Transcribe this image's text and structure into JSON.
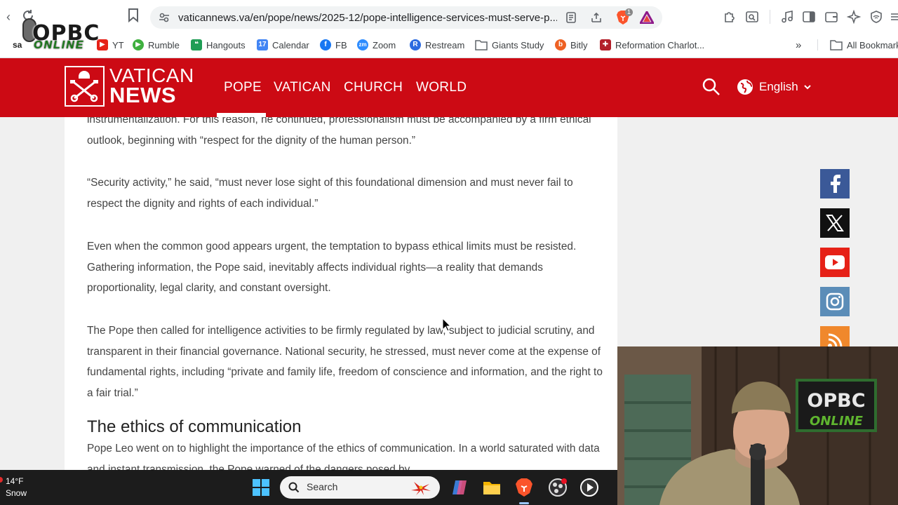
{
  "browser": {
    "url": "vaticannews.va/en/pope/news/2025-12/pope-intelligence-services-must-serve-p...",
    "bookmarks": [
      {
        "label": "YT"
      },
      {
        "label": "Rumble"
      },
      {
        "label": "Hangouts"
      },
      {
        "label": "Calendar"
      },
      {
        "label": "FB"
      },
      {
        "label": "Zoom"
      },
      {
        "label": "Restream"
      },
      {
        "label": "Giants Study"
      },
      {
        "label": "Bitly"
      },
      {
        "label": "Reformation Charlot..."
      }
    ],
    "all_bookmarks_label": "All Bookmark",
    "overflow_label": "»",
    "brave_badge": "1"
  },
  "watermark": {
    "line1": "OPBC",
    "line2": "ONLINE"
  },
  "site": {
    "logo_line1": "VATICAN",
    "logo_line2": "NEWS",
    "nav": [
      "POPE",
      "VATICAN",
      "CHURCH",
      "WORLD"
    ],
    "language": "English",
    "brand_color": "#cc0a14"
  },
  "article": {
    "paragraphs": [
      "instrumentalization. For this reason, he continued, professionalism must be accompanied by a firm ethical outlook, beginning with “respect for the dignity of the human person.”",
      "“Security activity,” he said, “must never lose sight of this foundational dimension and must never fail to respect the dignity and rights of each individual.”",
      "Even when the common good appears urgent, the temptation to bypass ethical limits must be resisted. Gathering information, the Pope said, inevitably affects individual rights—a reality that demands proportionality, legal clarity, and constant oversight.",
      "The Pope then called for intelligence activities to be firmly regulated by law, subject to judicial scrutiny, and transparent in their financial governance. National security, he stressed, must never come at the expense of fundamental rights, including “private and family life, freedom of conscience and information, and the right to a fair trial.”"
    ],
    "section_heading": "The ethics of communication",
    "section_paragraph": "Pope Leo went on to highlight the importance of the ethics of communication. In a world saturated with data and instant transmission, the Pope warned of the dangers posed by"
  },
  "social": [
    {
      "name": "facebook",
      "color": "#3b5998"
    },
    {
      "name": "x",
      "color": "#111111"
    },
    {
      "name": "youtube",
      "color": "#e62117"
    },
    {
      "name": "instagram",
      "color": "#5b8db8"
    },
    {
      "name": "rss",
      "color": "#f0882c"
    }
  ],
  "webcam": {
    "sign_line1": "OPBC",
    "sign_line2": "ONLINE"
  },
  "taskbar": {
    "temperature": "14°F",
    "condition": "Snow",
    "search_label": "Search"
  }
}
